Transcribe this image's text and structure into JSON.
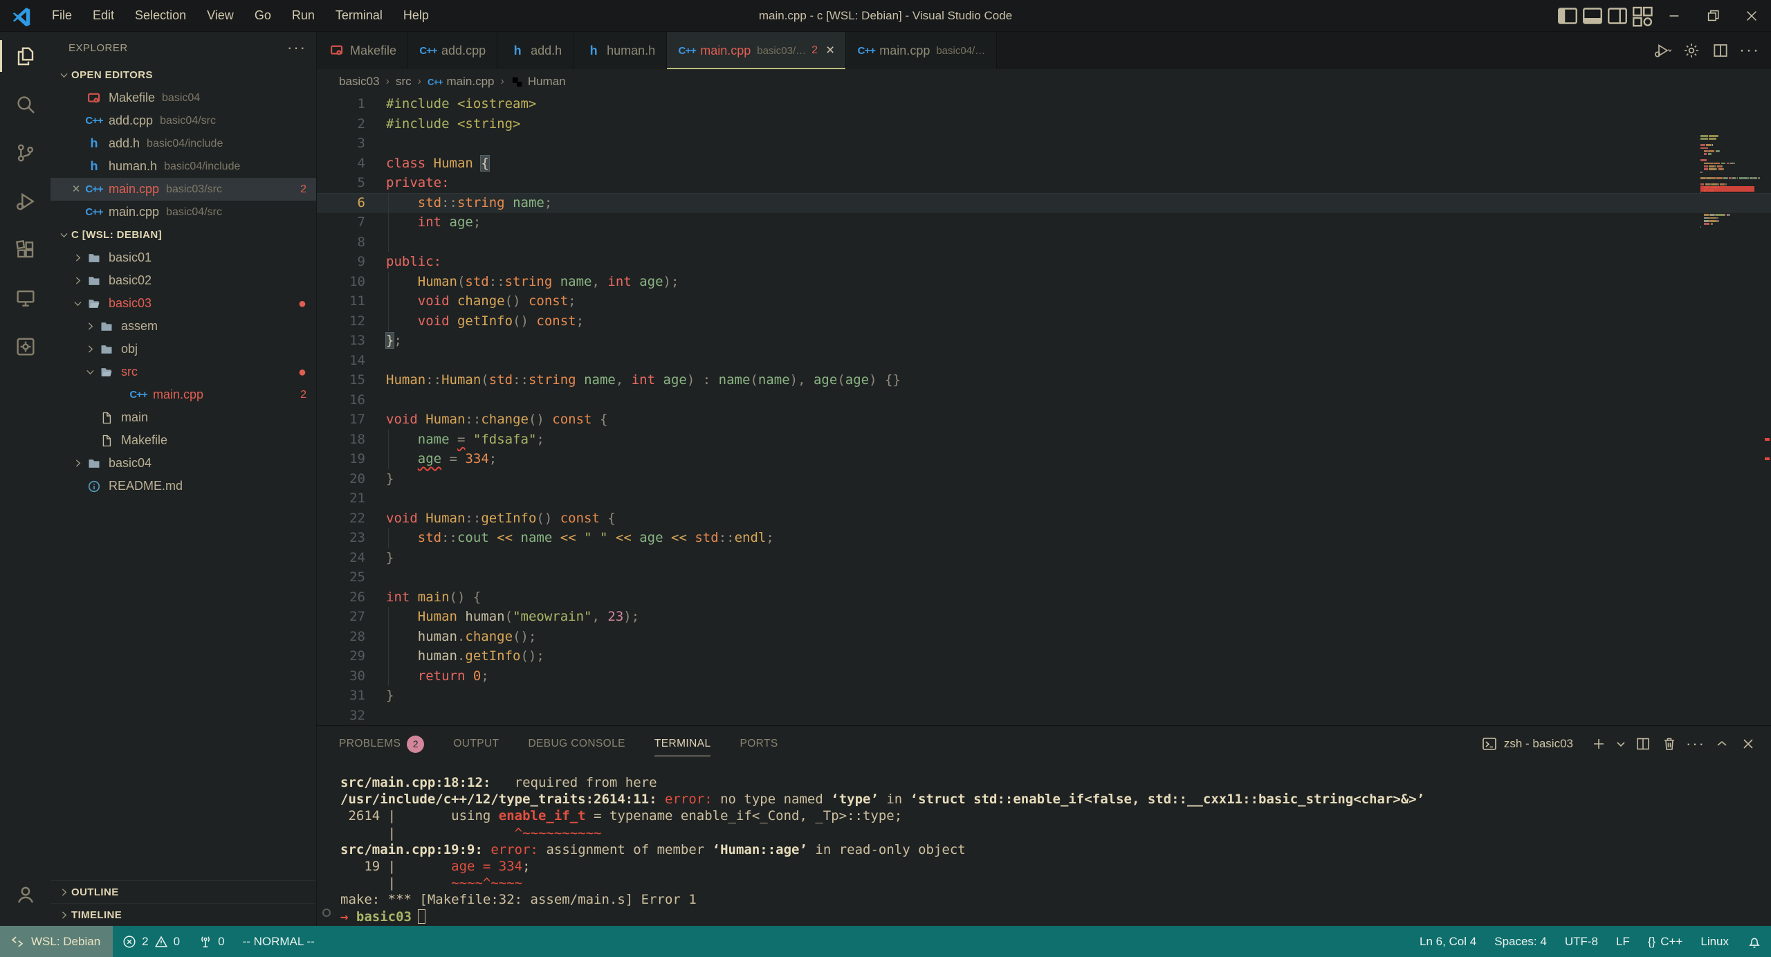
{
  "window": {
    "title": "main.cpp - c [WSL: Debian] - Visual Studio Code",
    "menus": [
      "File",
      "Edit",
      "Selection",
      "View",
      "Go",
      "Run",
      "Terminal",
      "Help"
    ]
  },
  "activity_bar": {
    "items": [
      {
        "name": "explorer",
        "active": true
      },
      {
        "name": "search"
      },
      {
        "name": "source-control"
      },
      {
        "name": "run-debug"
      },
      {
        "name": "extensions"
      },
      {
        "name": "remote-explorer"
      },
      {
        "name": "tools"
      }
    ],
    "bottom": [
      {
        "name": "account"
      }
    ]
  },
  "sidebar": {
    "header": "EXPLORER",
    "open_editors_label": "OPEN EDITORS",
    "open_editors": [
      {
        "icon": "makefile",
        "name": "Makefile",
        "desc": "basic04"
      },
      {
        "icon": "cpp",
        "name": "add.cpp",
        "desc": "basic04/src"
      },
      {
        "icon": "h",
        "name": "add.h",
        "desc": "basic04/include"
      },
      {
        "icon": "h",
        "name": "human.h",
        "desc": "basic04/include"
      },
      {
        "icon": "cpp",
        "name": "main.cpp",
        "desc": "basic03/src",
        "badge": "2",
        "error": true,
        "active": true
      },
      {
        "icon": "cpp",
        "name": "main.cpp",
        "desc": "basic04/src"
      }
    ],
    "tree_root": "C [WSL: DEBIAN]",
    "tree": [
      {
        "label": "basic01",
        "icon": "folder",
        "chev": "right",
        "level": 1
      },
      {
        "label": "basic02",
        "icon": "folder",
        "chev": "right",
        "level": 1
      },
      {
        "label": "basic03",
        "icon": "folder-open",
        "chev": "down",
        "level": 1,
        "error": true,
        "dot": true
      },
      {
        "label": "assem",
        "icon": "folder",
        "chev": "right",
        "level": 2
      },
      {
        "label": "obj",
        "icon": "folder",
        "chev": "right",
        "level": 2
      },
      {
        "label": "src",
        "icon": "folder-open",
        "chev": "down",
        "level": 2,
        "error": true,
        "dot": true
      },
      {
        "label": "main.cpp",
        "icon": "cpp",
        "level": 3,
        "error": true,
        "badge": "2"
      },
      {
        "label": "main",
        "icon": "file",
        "level": 2
      },
      {
        "label": "Makefile",
        "icon": "file",
        "level": 2
      },
      {
        "label": "basic04",
        "icon": "folder",
        "chev": "right",
        "level": 1
      },
      {
        "label": "README.md",
        "icon": "info",
        "level": 1
      }
    ],
    "bottom_sections": [
      "OUTLINE",
      "TIMELINE"
    ]
  },
  "tabs": [
    {
      "icon": "makefile",
      "name": "Makefile"
    },
    {
      "icon": "cpp",
      "name": "add.cpp"
    },
    {
      "icon": "h",
      "name": "add.h"
    },
    {
      "icon": "h",
      "name": "human.h"
    },
    {
      "icon": "cpp",
      "name": "main.cpp",
      "desc": "basic03/…",
      "badge": "2",
      "active": true,
      "error": true,
      "close": "×"
    },
    {
      "icon": "cpp",
      "name": "main.cpp",
      "desc": "basic04/…"
    }
  ],
  "editor_actions": [
    "run-debug-play",
    "gear",
    "split-editor",
    "more"
  ],
  "breadcrumb": [
    {
      "label": "basic03"
    },
    {
      "label": "src"
    },
    {
      "label": "main.cpp",
      "icon": "cpp"
    },
    {
      "label": "Human",
      "icon": "symbol-class"
    }
  ],
  "code": {
    "current_line": 6,
    "lines": [
      {
        "n": 1,
        "t": [
          [
            "#include",
            "pp"
          ],
          [
            " ",
            "ws"
          ],
          [
            "<iostream>",
            "hd"
          ]
        ]
      },
      {
        "n": 2,
        "t": [
          [
            "#include",
            "pp"
          ],
          [
            " ",
            "ws"
          ],
          [
            "<string>",
            "hd"
          ]
        ]
      },
      {
        "n": 3,
        "t": []
      },
      {
        "n": 4,
        "t": [
          [
            "class",
            "kw"
          ],
          [
            " ",
            "ws"
          ],
          [
            "Human",
            "ty"
          ],
          [
            " ",
            "ws"
          ],
          [
            "{",
            "bx"
          ]
        ]
      },
      {
        "n": 5,
        "t": [
          [
            "private",
            "kw"
          ],
          [
            ":",
            "kw"
          ]
        ]
      },
      {
        "n": 6,
        "t": [
          [
            "    ",
            "ws"
          ],
          [
            "std",
            "or"
          ],
          [
            "::",
            "pu"
          ],
          [
            "string",
            "or"
          ],
          [
            " ",
            "ws"
          ],
          [
            "name",
            "va"
          ],
          [
            ";",
            "pu"
          ]
        ]
      },
      {
        "n": 7,
        "t": [
          [
            "    ",
            "ws"
          ],
          [
            "int",
            "kw"
          ],
          [
            " ",
            "ws"
          ],
          [
            "age",
            "va"
          ],
          [
            ";",
            "pu"
          ]
        ]
      },
      {
        "n": 8,
        "t": [],
        "g": true
      },
      {
        "n": 9,
        "t": [
          [
            "public",
            "kw"
          ],
          [
            ":",
            "kw"
          ]
        ]
      },
      {
        "n": 10,
        "t": [
          [
            "    ",
            "ws"
          ],
          [
            "Human",
            "fn"
          ],
          [
            "(",
            "pu"
          ],
          [
            "std",
            "or"
          ],
          [
            "::",
            "pu"
          ],
          [
            "string",
            "or"
          ],
          [
            " ",
            "ws"
          ],
          [
            "name",
            "va"
          ],
          [
            ",",
            "pu"
          ],
          [
            " ",
            "ws"
          ],
          [
            "int",
            "kw"
          ],
          [
            " ",
            "ws"
          ],
          [
            "age",
            "va"
          ],
          [
            ")",
            "pu"
          ],
          [
            ";",
            "pu"
          ]
        ]
      },
      {
        "n": 11,
        "t": [
          [
            "    ",
            "ws"
          ],
          [
            "void",
            "kw"
          ],
          [
            " ",
            "ws"
          ],
          [
            "change",
            "fn"
          ],
          [
            "()",
            "pu"
          ],
          [
            " ",
            "ws"
          ],
          [
            "const",
            "or"
          ],
          [
            ";",
            "pu"
          ]
        ]
      },
      {
        "n": 12,
        "t": [
          [
            "    ",
            "ws"
          ],
          [
            "void",
            "kw"
          ],
          [
            " ",
            "ws"
          ],
          [
            "getInfo",
            "fn"
          ],
          [
            "()",
            "pu"
          ],
          [
            " ",
            "ws"
          ],
          [
            "const",
            "or"
          ],
          [
            ";",
            "pu"
          ]
        ]
      },
      {
        "n": 13,
        "t": [
          [
            "}",
            "bx"
          ],
          [
            ";",
            "pu"
          ]
        ]
      },
      {
        "n": 14,
        "t": []
      },
      {
        "n": 15,
        "t": [
          [
            "Human",
            "ty"
          ],
          [
            "::",
            "pu"
          ],
          [
            "Human",
            "fn"
          ],
          [
            "(",
            "pu"
          ],
          [
            "std",
            "or"
          ],
          [
            "::",
            "pu"
          ],
          [
            "string",
            "or"
          ],
          [
            " ",
            "ws"
          ],
          [
            "name",
            "va"
          ],
          [
            ",",
            "pu"
          ],
          [
            " ",
            "ws"
          ],
          [
            "int",
            "kw"
          ],
          [
            " ",
            "ws"
          ],
          [
            "age",
            "va"
          ],
          [
            ")",
            "pu"
          ],
          [
            " ",
            "ws"
          ],
          [
            ":",
            "pu"
          ],
          [
            " ",
            "ws"
          ],
          [
            "name",
            "va"
          ],
          [
            "(",
            "pu"
          ],
          [
            "name",
            "va"
          ],
          [
            "),",
            "pu"
          ],
          [
            " ",
            "ws"
          ],
          [
            "age",
            "va"
          ],
          [
            "(",
            "pu"
          ],
          [
            "age",
            "va"
          ],
          [
            ")",
            "pu"
          ],
          [
            " ",
            "ws"
          ],
          [
            "{}",
            "pu"
          ]
        ]
      },
      {
        "n": 16,
        "t": []
      },
      {
        "n": 17,
        "t": [
          [
            "void",
            "kw"
          ],
          [
            " ",
            "ws"
          ],
          [
            "Human",
            "ty"
          ],
          [
            "::",
            "pu"
          ],
          [
            "change",
            "fn"
          ],
          [
            "()",
            "pu"
          ],
          [
            " ",
            "ws"
          ],
          [
            "const",
            "or"
          ],
          [
            " ",
            "ws"
          ],
          [
            "{",
            "pu"
          ]
        ]
      },
      {
        "n": 18,
        "t": [
          [
            "    ",
            "ws"
          ],
          [
            "name",
            "va"
          ],
          [
            " ",
            "ws"
          ],
          [
            "=",
            "pu sq"
          ],
          [
            " ",
            "ws"
          ],
          [
            "\"fdsafa\"",
            "st"
          ],
          [
            ";",
            "pu"
          ]
        ]
      },
      {
        "n": 19,
        "t": [
          [
            "    ",
            "ws"
          ],
          [
            "age",
            "va sq"
          ],
          [
            " ",
            "ws"
          ],
          [
            "=",
            "pu"
          ],
          [
            " ",
            "ws"
          ],
          [
            "334",
            "or"
          ],
          [
            ";",
            "pu"
          ]
        ]
      },
      {
        "n": 20,
        "t": [
          [
            "}",
            "pu"
          ]
        ]
      },
      {
        "n": 21,
        "t": []
      },
      {
        "n": 22,
        "t": [
          [
            "void",
            "kw"
          ],
          [
            " ",
            "ws"
          ],
          [
            "Human",
            "ty"
          ],
          [
            "::",
            "pu"
          ],
          [
            "getInfo",
            "fn"
          ],
          [
            "()",
            "pu"
          ],
          [
            " ",
            "ws"
          ],
          [
            "const",
            "or"
          ],
          [
            " ",
            "ws"
          ],
          [
            "{",
            "pu"
          ]
        ]
      },
      {
        "n": 23,
        "t": [
          [
            "    ",
            "ws"
          ],
          [
            "std",
            "or"
          ],
          [
            "::",
            "pu"
          ],
          [
            "cout",
            "va"
          ],
          [
            " ",
            "ws"
          ],
          [
            "<<",
            "op"
          ],
          [
            " ",
            "ws"
          ],
          [
            "name",
            "va"
          ],
          [
            " ",
            "ws"
          ],
          [
            "<<",
            "op"
          ],
          [
            " ",
            "ws"
          ],
          [
            "\" \"",
            "st"
          ],
          [
            " ",
            "ws"
          ],
          [
            "<<",
            "op"
          ],
          [
            " ",
            "ws"
          ],
          [
            "age",
            "va"
          ],
          [
            " ",
            "ws"
          ],
          [
            "<<",
            "op"
          ],
          [
            " ",
            "ws"
          ],
          [
            "std",
            "or"
          ],
          [
            "::",
            "pu"
          ],
          [
            "endl",
            "fn"
          ],
          [
            ";",
            "pu"
          ]
        ]
      },
      {
        "n": 24,
        "t": [
          [
            "}",
            "pu"
          ]
        ]
      },
      {
        "n": 25,
        "t": []
      },
      {
        "n": 26,
        "t": [
          [
            "int",
            "kw"
          ],
          [
            " ",
            "ws"
          ],
          [
            "main",
            "fn"
          ],
          [
            "()",
            "pu"
          ],
          [
            " ",
            "ws"
          ],
          [
            "{",
            "pu"
          ]
        ]
      },
      {
        "n": 27,
        "t": [
          [
            "    ",
            "ws"
          ],
          [
            "Human",
            "ty"
          ],
          [
            " ",
            "ws"
          ],
          [
            "human",
            "pl"
          ],
          [
            "(",
            "pu"
          ],
          [
            "\"meowrain\"",
            "st"
          ],
          [
            ",",
            "pu"
          ],
          [
            " ",
            "ws"
          ],
          [
            "23",
            "nm"
          ],
          [
            ")",
            "pu"
          ],
          [
            ";",
            "pu"
          ]
        ]
      },
      {
        "n": 28,
        "t": [
          [
            "    ",
            "ws"
          ],
          [
            "human",
            "pl"
          ],
          [
            ".",
            "pu"
          ],
          [
            "change",
            "fn"
          ],
          [
            "()",
            "pu"
          ],
          [
            ";",
            "pu"
          ]
        ]
      },
      {
        "n": 29,
        "t": [
          [
            "    ",
            "ws"
          ],
          [
            "human",
            "pl"
          ],
          [
            ".",
            "pu"
          ],
          [
            "getInfo",
            "fn"
          ],
          [
            "()",
            "pu"
          ],
          [
            ";",
            "pu"
          ]
        ]
      },
      {
        "n": 30,
        "t": [
          [
            "    ",
            "ws"
          ],
          [
            "return",
            "kw"
          ],
          [
            " ",
            "ws"
          ],
          [
            "0",
            "or"
          ],
          [
            ";",
            "pu"
          ]
        ]
      },
      {
        "n": 31,
        "t": [
          [
            "}",
            "pu"
          ]
        ]
      },
      {
        "n": 32,
        "t": []
      }
    ],
    "error_lines": [
      18,
      19
    ]
  },
  "panel": {
    "tabs": [
      {
        "label": "PROBLEMS",
        "badge": "2"
      },
      {
        "label": "OUTPUT"
      },
      {
        "label": "DEBUG CONSOLE"
      },
      {
        "label": "TERMINAL",
        "active": true
      },
      {
        "label": "PORTS"
      }
    ],
    "terminal_title": "zsh - basic03",
    "actions": [
      "plus",
      "chevron-down",
      "split-editor",
      "trash",
      "more",
      "chevron-up",
      "close"
    ],
    "terminal_lines": [
      [
        [
          "src/main.cpp:18:12:",
          "b"
        ],
        [
          "   required from here",
          "n"
        ]
      ],
      [
        [
          "/usr/include/c++/12/type_traits:2614:11:",
          "b"
        ],
        [
          " ",
          "n"
        ],
        [
          "error:",
          "e"
        ],
        [
          " no type named ",
          "n"
        ],
        [
          "‘type’",
          "b"
        ],
        [
          " in ",
          "n"
        ],
        [
          "‘struct std::enable_if<false, std::__cxx11::basic_string<char>&>’",
          "b"
        ]
      ],
      [
        [
          " 2614 |       using ",
          "n"
        ],
        [
          "enable_if_t",
          "eb"
        ],
        [
          " = typename enable_if<_Cond, _Tp>::type;",
          "n"
        ]
      ],
      [
        [
          "      |               ",
          "n"
        ],
        [
          "^~~~~~~~~~~",
          "e"
        ]
      ],
      [
        [
          "src/main.cpp:19:9:",
          "b"
        ],
        [
          " ",
          "n"
        ],
        [
          "error:",
          "e"
        ],
        [
          " assignment of member ",
          "n"
        ],
        [
          "‘Human::age’",
          "b"
        ],
        [
          " in read-only object",
          "n"
        ]
      ],
      [
        [
          "   19 |       ",
          "n"
        ],
        [
          "age = 334",
          "e"
        ],
        [
          ";",
          "n"
        ]
      ],
      [
        [
          "      |       ",
          "n"
        ],
        [
          "~~~~^~~~~",
          "e"
        ]
      ],
      [
        [
          "make: *** [Makefile:32: assem/main.s] Error 1",
          "n"
        ]
      ]
    ],
    "prompt": {
      "arrow": "→",
      "cwd": "basic03"
    }
  },
  "status_bar": {
    "remote": "WSL: Debian",
    "errors": "2",
    "warnings": "0",
    "ports": "0",
    "mode": "-- NORMAL --",
    "line_col": "Ln 6, Col 4",
    "indent": "Spaces: 4",
    "encoding": "UTF-8",
    "eol": "LF",
    "lang_braces": "{}",
    "language": "C++",
    "os": "Linux"
  }
}
